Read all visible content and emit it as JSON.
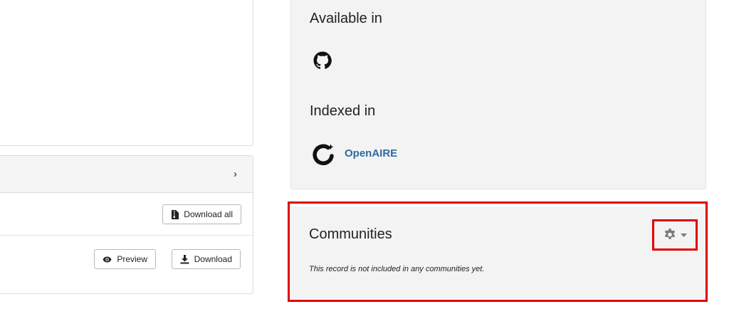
{
  "files": {
    "download_all_label": "Download all",
    "preview_label": "Preview",
    "download_label": "Download"
  },
  "sidebar": {
    "available_in_title": "Available in",
    "available_in_items": [
      {
        "icon": "github-icon"
      }
    ],
    "indexed_in_title": "Indexed in",
    "indexed_in_items": [
      {
        "icon": "openaire-icon",
        "label": "OpenAIRE"
      }
    ]
  },
  "communities": {
    "title": "Communities",
    "note": "This record is not included in any communities yet.",
    "manage_icon": "gear-icon"
  },
  "colors": {
    "link": "#2e6aa3",
    "highlight": "#e00000",
    "panel_bg": "#f3f3f3"
  }
}
